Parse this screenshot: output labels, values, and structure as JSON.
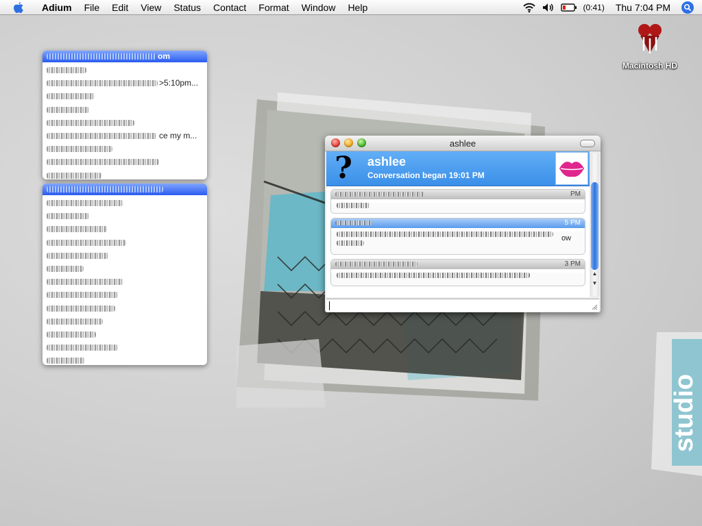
{
  "menubar": {
    "app_name": "Adium",
    "items": [
      "File",
      "Edit",
      "View",
      "Status",
      "Contact",
      "Format",
      "Window",
      "Help"
    ],
    "battery_text": "(0:41)",
    "clock": "Thu 7:04 PM",
    "icons": [
      "apple-icon",
      "wifi-icon",
      "volume-icon",
      "battery-icon",
      "spotlight-icon"
    ]
  },
  "desktop": {
    "hd_label": "Macintosh HD",
    "wallpaper_text": "studio"
  },
  "contact_lists": {
    "top": {
      "header_suffix": "om",
      "rows": [
        {
          "suffix": ""
        },
        {
          "suffix": ">5:10pm..."
        },
        {
          "suffix": ""
        },
        {
          "suffix": ""
        },
        {
          "suffix": ""
        },
        {
          "suffix": "ce my m..."
        },
        {
          "suffix": ""
        },
        {
          "suffix": ""
        },
        {
          "suffix": ""
        }
      ]
    },
    "bottom": {
      "row_count": 13
    }
  },
  "chat": {
    "window_title": "ashlee",
    "contact_name": "ashlee",
    "conversation_began": "Conversation began 19:01 PM",
    "messages": [
      {
        "style": "gray",
        "time": "PM",
        "body_end": ""
      },
      {
        "style": "blue",
        "time": "5 PM",
        "body_end": "ow"
      },
      {
        "style": "gray",
        "time": "3 PM",
        "body_end": ""
      }
    ],
    "input_value": ""
  },
  "colors": {
    "header_blue": "#3a8fe8",
    "list_header_blue": "#2b5bf0",
    "accent_teal": "#5fb7c9"
  }
}
